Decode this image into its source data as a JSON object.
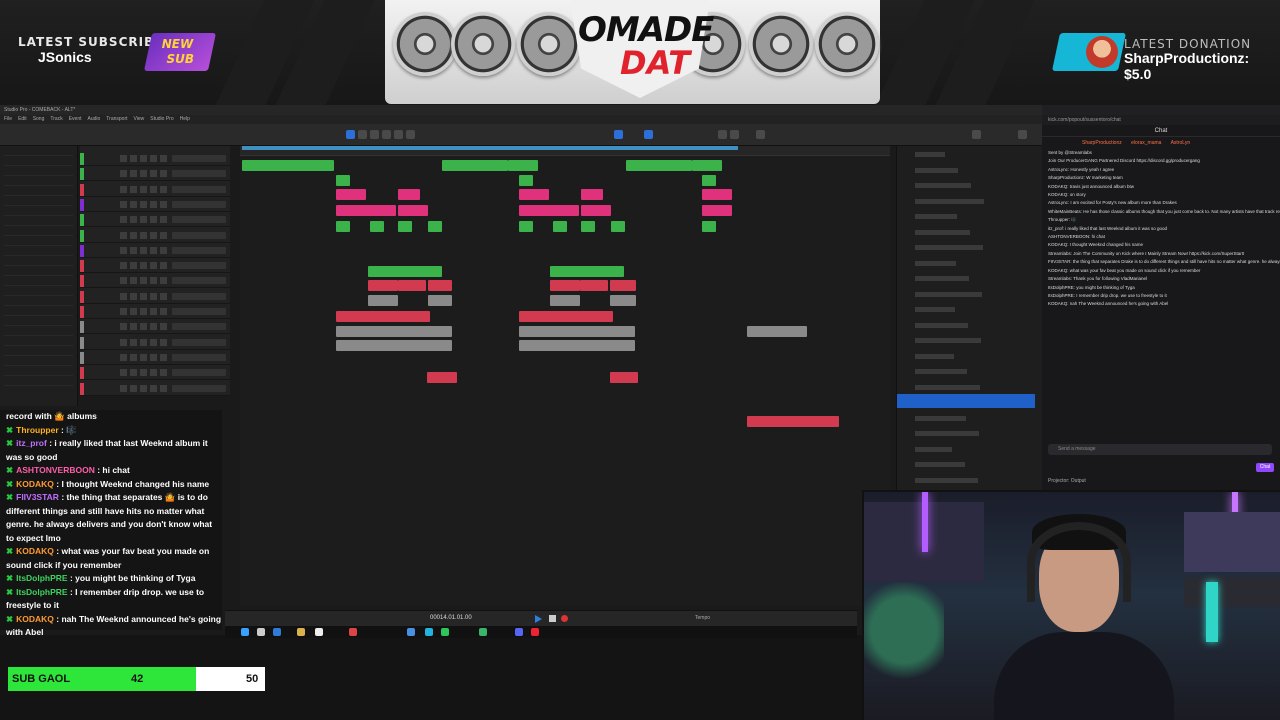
{
  "overlay": {
    "latest_subscriber_label": "LATEST SUBSCRIBER",
    "latest_subscriber_name": "JSonics",
    "new_sub_badge_line1": "NEW",
    "new_sub_badge_line2": "SUB",
    "brand_logo_line1": "OMADE",
    "brand_logo_line2": "DAT",
    "latest_donation_label": "LATEST DONATION",
    "latest_donation_text": "SharpProductionz: $5.0"
  },
  "sub_goal": {
    "label": "SUB GAOL",
    "current": "42",
    "target": "50",
    "progress": 0.84
  },
  "stream_chat": {
    "header": "record with 🤷 albums",
    "messages": [
      {
        "user": "Throupper",
        "color": "#ffb020",
        "text": "🎼"
      },
      {
        "user": "itz_prof",
        "color": "#c070ff",
        "text": "i really liked that last Weeknd album it was so good"
      },
      {
        "user": "ASHTONVERBOON",
        "color": "#ff5fa8",
        "text": "hi chat"
      },
      {
        "user": "KODAKQ",
        "color": "#ff9b30",
        "text": "I thought Weeknd changed his name"
      },
      {
        "user": "FIIV3STAR",
        "color": "#c070ff",
        "text": "the thing that separates 🤷 is to do different things and still have hits no matter what genre. he always delivers and you don't know what to expect lmo"
      },
      {
        "user": "KODAKQ",
        "color": "#ff9b30",
        "text": "what was your fav beat you made on sound click if you remember"
      },
      {
        "user": "ItsDolphPRE",
        "color": "#3fd35f",
        "text": "you might be thinking of Tyga"
      },
      {
        "user": "ItsDolphPRE",
        "color": "#3fd35f",
        "text": "I remember drip drop. we use to freestyle to it"
      },
      {
        "user": "KODAKQ",
        "color": "#ff9b30",
        "text": "nah The Weeknd announced he's going with Abel"
      }
    ]
  },
  "twitch_chat": {
    "url": "kick.com/popout/sussentoro/chat",
    "title": "Chat",
    "top_users": [
      "SharpProductionz",
      "elorax_mama",
      "AstroLyn"
    ],
    "input_placeholder": "Send a message",
    "send_label": "Chat",
    "projector_label": "Projector: Output",
    "messages": [
      "Sent by @Streamlabs",
      "Join Our ProducerGANG Partnered Discord https://discord.gg/producergang",
      "AstroLync: Honestly yeah I agree",
      "SharpProductionz: W marketing team",
      "KODAKQ: travis just announced album btw",
      "KODAKQ: on story",
      "AstroLync: I am excited for Posty's new album more than Drakes",
      "WhiteMainBeats: He has those classic albums though that you just come back to. Not many artists have that track record with Classic albums",
      "Throupper: 🎼",
      "itz_prof: i really liked that last Weeknd album it was so good",
      "ASHTONVERBOON: hi chat",
      "KODAKQ: I thought Weeknd changed his name",
      "Streamlabs: Join The Community on Kick where I Mainly Stream Now! https://kick.com/SuperStar0",
      "FIIV3STAR: the thing that separates Drake is to do different things and still have hits no matter what genre. he always delivers and you don't know what to expect lmo",
      "KODAKQ: what was your fav beat you made on sound click if you remember",
      "Streamlabs: Thank you for following VladMarianel",
      "ItsDolphPRE: you might be thinking of Tyga",
      "ItsDolphPRE: I remember drip drop. we use to freestyle to it",
      "KODAKQ: nah The Weeknd announced he's going with Abel"
    ]
  },
  "daw": {
    "window_title": "Studio Pro - COMEBACK - ALT*",
    "menu_items": [
      "File",
      "Edit",
      "Song",
      "Track",
      "Event",
      "Audio",
      "Transport",
      "View",
      "Studio Pro",
      "Help"
    ],
    "transport_time": "00014.01.01.00",
    "tempo_label": "Tempo"
  },
  "colors": {
    "accent_blue": "#1f60c9",
    "clip_green": "#3bb24a",
    "clip_pink": "#e0317c",
    "clip_red": "#d23a4f",
    "clip_purple": "#7d2fd0",
    "clip_gray": "#8a8a8a",
    "goal_green": "#2ee63a"
  }
}
